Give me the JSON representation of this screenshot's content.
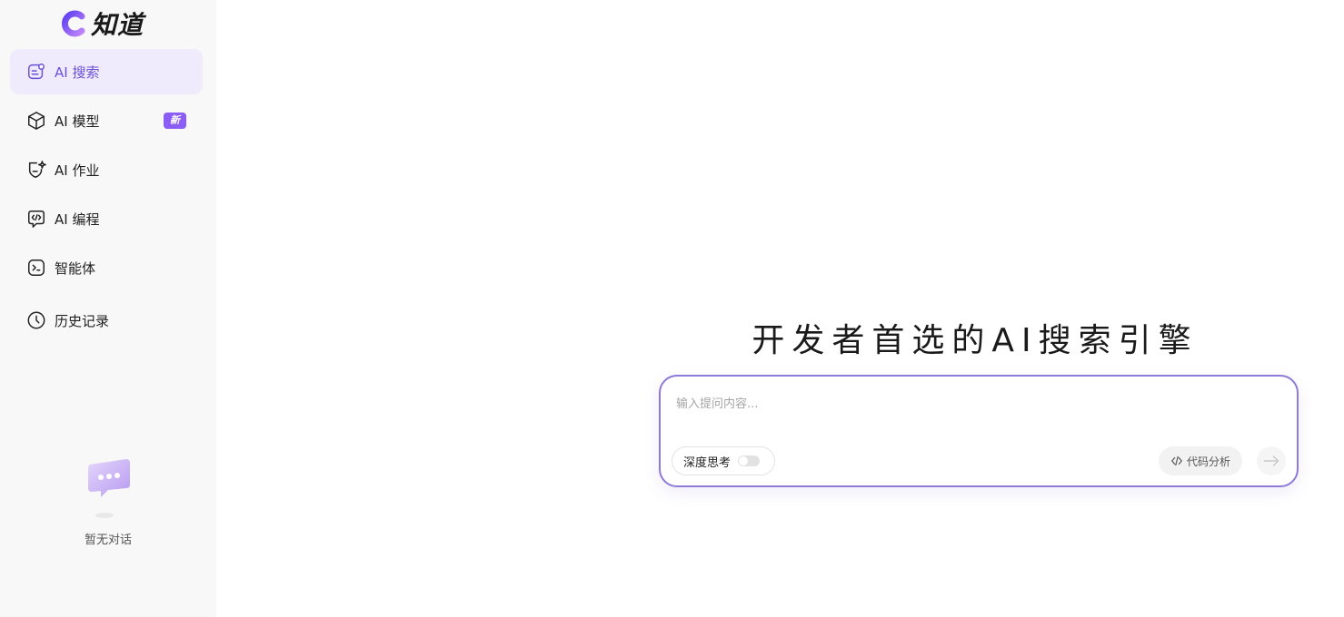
{
  "brand": {
    "name": "知道",
    "accent": "#6a52d8"
  },
  "sidebar": {
    "items": [
      {
        "label": "AI 搜索",
        "icon": "ai-search-icon",
        "active": true
      },
      {
        "label": "AI 模型",
        "icon": "cube-icon",
        "badge": "新"
      },
      {
        "label": "AI 作业",
        "icon": "shield-sparkle-icon"
      },
      {
        "label": "AI 编程",
        "icon": "code-bubble-icon"
      },
      {
        "label": "智能体",
        "icon": "terminal-icon"
      },
      {
        "label": "历史记录",
        "icon": "clock-icon"
      }
    ],
    "empty_text": "暂无对话"
  },
  "main": {
    "headline": "开发者首选的AI搜索引擎",
    "composer": {
      "placeholder": "输入提问内容...",
      "deep_think_label": "深度思考",
      "deep_think_on": false,
      "code_analysis_label": "代码分析"
    }
  }
}
